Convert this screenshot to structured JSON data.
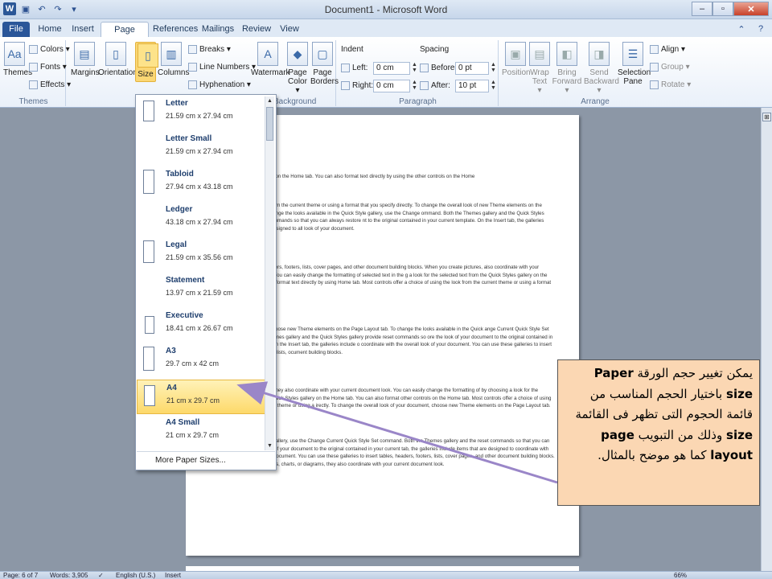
{
  "window": {
    "title": "Document1 - Microsoft Word",
    "qat_icons": [
      "word-logo-icon",
      "save-icon",
      "undo-icon",
      "redo-icon",
      "customize-qat-icon"
    ],
    "controls": {
      "minimize": "–",
      "restore": "▫",
      "close": "✕"
    }
  },
  "tabs": [
    "File",
    "Home",
    "Insert",
    "Page Layout",
    "References",
    "Mailings",
    "Review",
    "View"
  ],
  "active_tab": "Page Layout",
  "ribbon": {
    "themes": {
      "label": "Themes",
      "big": "Themes",
      "colors": "Colors ▾",
      "fonts": "Fonts ▾",
      "effects": "Effects ▾"
    },
    "page_setup": {
      "margins": "Margins",
      "orientation": "Orientation",
      "size": "Size",
      "columns": "Columns",
      "breaks": "Breaks ▾",
      "line_numbers": "Line Numbers ▾",
      "hyphenation": "Hyphenation ▾"
    },
    "page_background": {
      "label": "e Background",
      "watermark": "Watermark",
      "page_color": "Page Color ▾",
      "page_borders": "Page Borders"
    },
    "paragraph": {
      "label": "Paragraph",
      "indent": "Indent",
      "left_label": "Left:",
      "left_value": "0 cm",
      "right_label": "Right:",
      "right_value": "0 cm",
      "spacing": "Spacing",
      "before_label": "Before:",
      "before_value": "0 pt",
      "after_label": "After:",
      "after_value": "10 pt"
    },
    "arrange": {
      "label": "Arrange",
      "position": "Position",
      "wrap_text": "Wrap Text ▾",
      "bring_forward": "Bring Forward ▾",
      "send_backward": "Send Backward ▾",
      "selection_pane": "Selection Pane",
      "align": "Align ▾",
      "group": "Group ▾",
      "rotate": "Rotate ▾"
    }
  },
  "size_menu": {
    "items": [
      {
        "name": "Letter",
        "dims": "21.59 cm x 27.94 cm"
      },
      {
        "name": "Letter Small",
        "dims": "21.59 cm x 27.94 cm"
      },
      {
        "name": "Tabloid",
        "dims": "27.94 cm x 43.18 cm"
      },
      {
        "name": "Ledger",
        "dims": "43.18 cm x 27.94 cm"
      },
      {
        "name": "Legal",
        "dims": "21.59 cm x 35.56 cm"
      },
      {
        "name": "Statement",
        "dims": "13.97 cm x 21.59 cm"
      },
      {
        "name": "Executive",
        "dims": "18.41 cm x 26.67 cm"
      },
      {
        "name": "A3",
        "dims": "29.7 cm x 42 cm"
      },
      {
        "name": "A4",
        "dims": "21 cm x 29.7 cm"
      },
      {
        "name": "A4 Small",
        "dims": "21 cm x 29.7 cm"
      }
    ],
    "selected": "A4",
    "more": "More Paper Sizes..."
  },
  "document": {
    "paragraphs": [
      "the Quick Styles gallery on the Home tab. You can also format text directly by using the other controls on the Home",
      "oice of using the look from the current theme or using a format that you specify directly. To change the overall look of new Theme elements on the Page Layout tab. To change the looks available in the Quick Style gallery, use the Change ommand. Both the Themes gallery and the Quick Styles gallery provide reset commands so that you can always restore nt to the original contained in your current template. On the Insert tab, the galleries include items that are designed to all look of your document.",
      "es to insert tables, headers, footers, lists, cover pages, and other document building blocks. When you create pictures, also coordinate with your current document look. You can easily change the formatting of selected text in the g a look for the selected text from the Quick Styles gallery on the Home tab. You can also format text directly by using Home tab. Most controls offer a choice of using the look from the current theme or using a format that you specify",
      "ok of your document, choose new Theme elements on the Page Layout tab. To change the looks available in the Quick ange Current Quick Style Set command. Both the Themes gallery and the Quick Styles gallery provide reset commands so ore the look of your document to the original contained in your current template. On the Insert tab, the galleries include o coordinate with the overall look of your document. You can use these galleries to insert tables, headers, footers, lists, ocument building blocks.",
      "ts, charts, or diagrams, they also coordinate with your current document look. You can easily change the formatting of by choosing a look for the selected text from the Quick Styles gallery on the Home tab. You can also format other controls on the Home tab. Most controls offer a choice of using the look from the current theme or using a irectly. To change the overall look of your document, choose new Theme elements on the Page Layout tab.",
      "able in the Quick Style gallery, use the Change Current Quick Style Set command. Both the Themes gallery and the reset commands so that you can always restore the look of your document to the original contained in your current tab, the galleries include items that are designed to coordinate with the overall look of your document. You can use these galleries to insert tables, headers, footers, lists, cover pages, and other document building blocks. When you create pictures, charts, or diagrams, they also coordinate with your current document look."
    ]
  },
  "callout": {
    "text_html_parts": [
      "يمكن تغيير حجم الورقة",
      "Paper size",
      "باختيار الحجم المناسب من قائمة الحجوم التى تظهر فى القائمة",
      "size",
      "وذلك من التبويب",
      "page layout",
      "كما هو موضح بالمثال."
    ]
  },
  "statusbar": {
    "page": "Page: 6 of 7",
    "words": "Words: 3,905",
    "language": "English (U.S.)",
    "mode": "Insert",
    "zoom": "66%"
  },
  "colors": {
    "accent": "#2a5699",
    "highlight": "#fdd96a",
    "callout": "#fbd7b3",
    "arrow": "#9a86c8"
  }
}
